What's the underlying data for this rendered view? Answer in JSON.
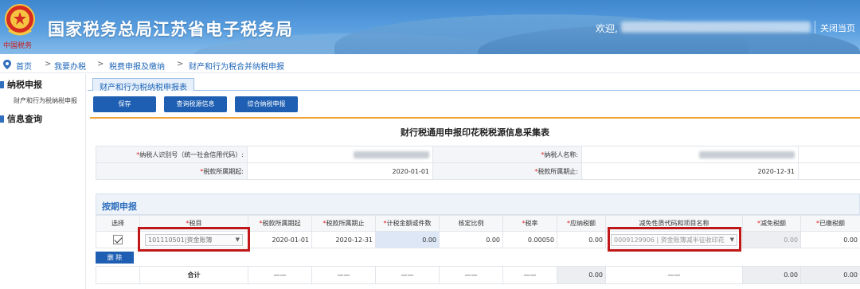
{
  "header": {
    "title": "国家税务总局江苏省电子税务局",
    "brand_sub": "中国税务",
    "welcome": "欢迎,",
    "close_page": "关闭当页"
  },
  "breadcrumb": {
    "items": [
      "首页",
      "我要办税",
      "税费申报及缴纳",
      "财产和行为税合并纳税申报"
    ],
    "separator": ">"
  },
  "sidebar": {
    "section1": "纳税申报",
    "sub1": "财产和行为税纳税申报",
    "section2": "信息查询"
  },
  "tab": {
    "active": "财产和行为税纳税申报表"
  },
  "toolbar": {
    "save": "保存",
    "query_source": "查询税源信息",
    "combined_declare": "综合纳税申报"
  },
  "form": {
    "title": "财行税通用申报印花税税源信息采集表",
    "taxpayer_id_label": "*纳税人识别号（统一社会信用代码）:",
    "taxpayer_name_label": "*纳税人名称:",
    "period_start_label": "*税款所属期起:",
    "period_start_value": "2020-01-01",
    "period_end_label": "*税款所属期止:",
    "period_end_value": "2020-12-31"
  },
  "section": {
    "title": "按期申报"
  },
  "grid": {
    "headers": [
      "选择",
      "*税目",
      "*税款所属期起",
      "*税款所属期止",
      "*计税金额或件数",
      "核定比例",
      "*税率",
      "*应纳税额",
      "减免性质代码和项目名称",
      "*减免税额",
      "*已缴税额"
    ],
    "row": {
      "tax_item": "101110501|资金账簿",
      "start": "2020-01-01",
      "end": "2020-12-31",
      "amount": "0.00",
      "ratio": "0.00",
      "rate": "0.00050",
      "payable": "0.00",
      "relief_code": "0009129906 | 资金账簿减半征收印花",
      "relief_amount": "0.00",
      "paid": "0.00"
    },
    "delete_btn": "删 除",
    "total": {
      "label": "合计",
      "dash": "——",
      "payable": "0.00",
      "relief_amount": "0.00",
      "paid": "0.00"
    }
  },
  "colors": {
    "header_blue": "#4a8fd6",
    "button_blue": "#1e5fb3",
    "accent_orange": "#f0a437",
    "highlight_red": "#c01818"
  }
}
